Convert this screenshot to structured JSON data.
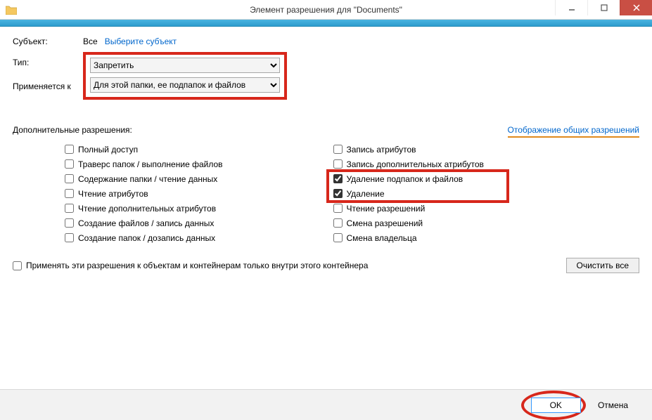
{
  "window": {
    "title": "Элемент разрешения для \"Documents\""
  },
  "top": {
    "subject_label": "Субъект:",
    "subject_all": "Все",
    "subject_link": "Выберите субъект",
    "type_label": "Тип:",
    "type_value": "Запретить",
    "applies_label": "Применяется к",
    "applies_value": "Для этой папки, ее подпапок и файлов"
  },
  "advanced": {
    "title": "Дополнительные разрешения:",
    "view_link": "Отображение общих разрешений",
    "col1": [
      {
        "label": "Полный доступ",
        "checked": false
      },
      {
        "label": "Траверс папок / выполнение файлов",
        "checked": false
      },
      {
        "label": "Содержание папки / чтение данных",
        "checked": false
      },
      {
        "label": "Чтение атрибутов",
        "checked": false
      },
      {
        "label": "Чтение дополнительных атрибутов",
        "checked": false
      },
      {
        "label": "Создание файлов / запись данных",
        "checked": false
      },
      {
        "label": "Создание папок / дозапись данных",
        "checked": false
      }
    ],
    "col2": [
      {
        "label": "Запись атрибутов",
        "checked": false
      },
      {
        "label": "Запись дополнительных атрибутов",
        "checked": false
      },
      {
        "label": "Удаление подпапок и файлов",
        "checked": true
      },
      {
        "label": "Удаление",
        "checked": true
      },
      {
        "label": "Чтение разрешений",
        "checked": false
      },
      {
        "label": "Смена разрешений",
        "checked": false
      },
      {
        "label": "Смена владельца",
        "checked": false
      }
    ],
    "only_container": "Применять эти разрешения к объектам и контейнерам только внутри этого контейнера",
    "clear_all": "Очистить все"
  },
  "footer": {
    "ok": "OK",
    "cancel": "Отмена"
  }
}
